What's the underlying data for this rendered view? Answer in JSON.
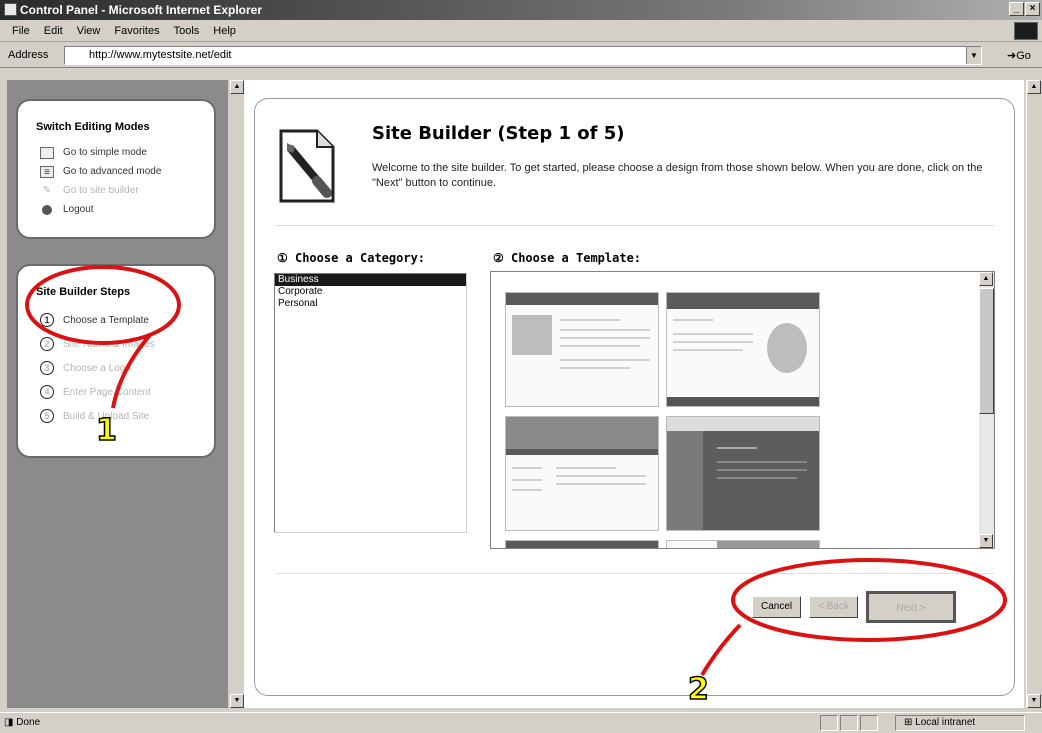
{
  "window": {
    "title": "Control Panel - Microsoft Internet Explorer",
    "buttons": [
      "_",
      "×"
    ]
  },
  "menu": [
    "File",
    "Edit",
    "View",
    "Favorites",
    "Tools",
    "Help"
  ],
  "address": {
    "label": "Address",
    "url": "http://www.mytestsite.net/edit",
    "go_label": "Go"
  },
  "sidebar": {
    "modes": {
      "heading": "Switch Editing Modes",
      "items": [
        {
          "label": "Go to simple mode",
          "icon": "simple-mode-icon",
          "disabled": false
        },
        {
          "label": "Go to advanced mode",
          "icon": "advanced-mode-icon",
          "disabled": false
        },
        {
          "label": "Go to site builder",
          "icon": "site-builder-icon",
          "disabled": true
        },
        {
          "label": "Logout",
          "icon": "logout-icon",
          "disabled": false
        }
      ]
    },
    "steps": {
      "heading": "Site Builder Steps",
      "items": [
        {
          "num": "1",
          "label": "Choose a Template",
          "disabled": false
        },
        {
          "num": "2",
          "label": "Site Name & Images",
          "disabled": true
        },
        {
          "num": "3",
          "label": "Choose a Logo",
          "disabled": true
        },
        {
          "num": "4",
          "label": "Enter Page Content",
          "disabled": true
        },
        {
          "num": "5",
          "label": "Build & Upload Site",
          "disabled": true
        }
      ]
    }
  },
  "main": {
    "title": "Site Builder (Step 1 of 5)",
    "intro": "Welcome to the site builder. To get started, please choose a design from those shown below. When you are done, click on the \"Next\" button to continue.",
    "category_title": "① Choose a Category:",
    "template_title": "② Choose a Template:",
    "categories": [
      "Business",
      "Corporate",
      "Personal"
    ],
    "selected_category": "Business",
    "buttons": {
      "cancel": "Cancel",
      "back": "< Back",
      "next": "Next >"
    }
  },
  "status": {
    "text": "Done",
    "zone": "Local intranet"
  },
  "annotations": [
    "1",
    "2"
  ],
  "colors": {
    "annotation_ring": "#dd1111",
    "annotation_number": "#ffff00"
  }
}
